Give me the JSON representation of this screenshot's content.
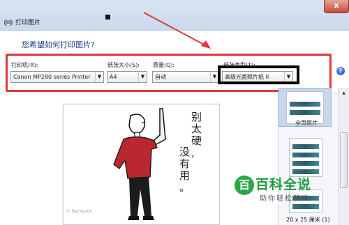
{
  "window": {
    "title": "打印图片",
    "close_label": "x"
  },
  "dialog": {
    "heading": "您希望如何打印图片?"
  },
  "controls": {
    "printer": {
      "label": "打印机(R):",
      "value": "Canon MP280 series Printer"
    },
    "paper_size": {
      "label": "纸张大小(S):",
      "value": "A4"
    },
    "quality": {
      "label": "质量(Q):",
      "value": "自动"
    },
    "paper_type": {
      "label": "纸张类型(T):",
      "value": "高级光面照片纸 II"
    }
  },
  "help_icon": "help-icon",
  "preview": {
    "text_col1": [
      "别",
      "太",
      "硬",
      ","
    ],
    "text_col2": [
      "没",
      "有",
      "用",
      "。"
    ],
    "credit": "© Backpack"
  },
  "layouts": [
    {
      "label": "全页照片"
    },
    {
      "label": ""
    },
    {
      "label": "20 x 25 厘米 (1)"
    }
  ],
  "watermark": {
    "logo": "百",
    "title": "百科全说",
    "subtitle": "助你轻松解决"
  },
  "colors": {
    "annotation_red": "#e0393a",
    "annotation_black": "#000000",
    "heading_blue": "#1e3f8a",
    "watermark_green": "#1f9b41"
  }
}
